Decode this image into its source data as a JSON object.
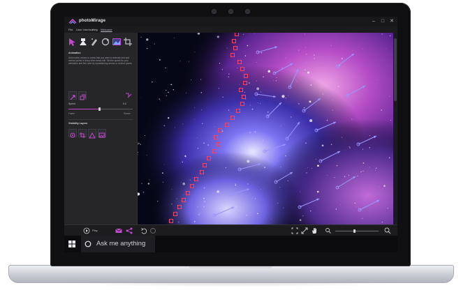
{
  "app": {
    "title": "photoMirage",
    "menu": [
      "File",
      "User Interface",
      "Help",
      "Welcome"
    ],
    "active_menu_index": 3
  },
  "left_panel": {
    "tools": [
      "arrow-tool",
      "anchor-tool",
      "eraser-tool",
      "loop-tool",
      "image-tool",
      "crop-tool"
    ],
    "animation": {
      "heading": "Animation",
      "description": "Add motion arrows to areas that you want to animate and add anchor points to keep other areas still. Set the speed for your animation and fine tune by repositioning arrows or anchor points.",
      "speed_label": "Speed",
      "speed_value": "5.0",
      "speed_fraction": 0.48,
      "faster_label": "Faster",
      "slower_label": "Slower"
    },
    "visibility": {
      "heading": "Visibility Layers"
    }
  },
  "toolbar": {
    "play_label": "Play"
  },
  "taskbar": {
    "search_placeholder": "Ask me anything"
  },
  "colors": {
    "accent": "#c34ad0",
    "anchor_point": "#ff4060",
    "motion_arrow": "#9a95ff"
  }
}
